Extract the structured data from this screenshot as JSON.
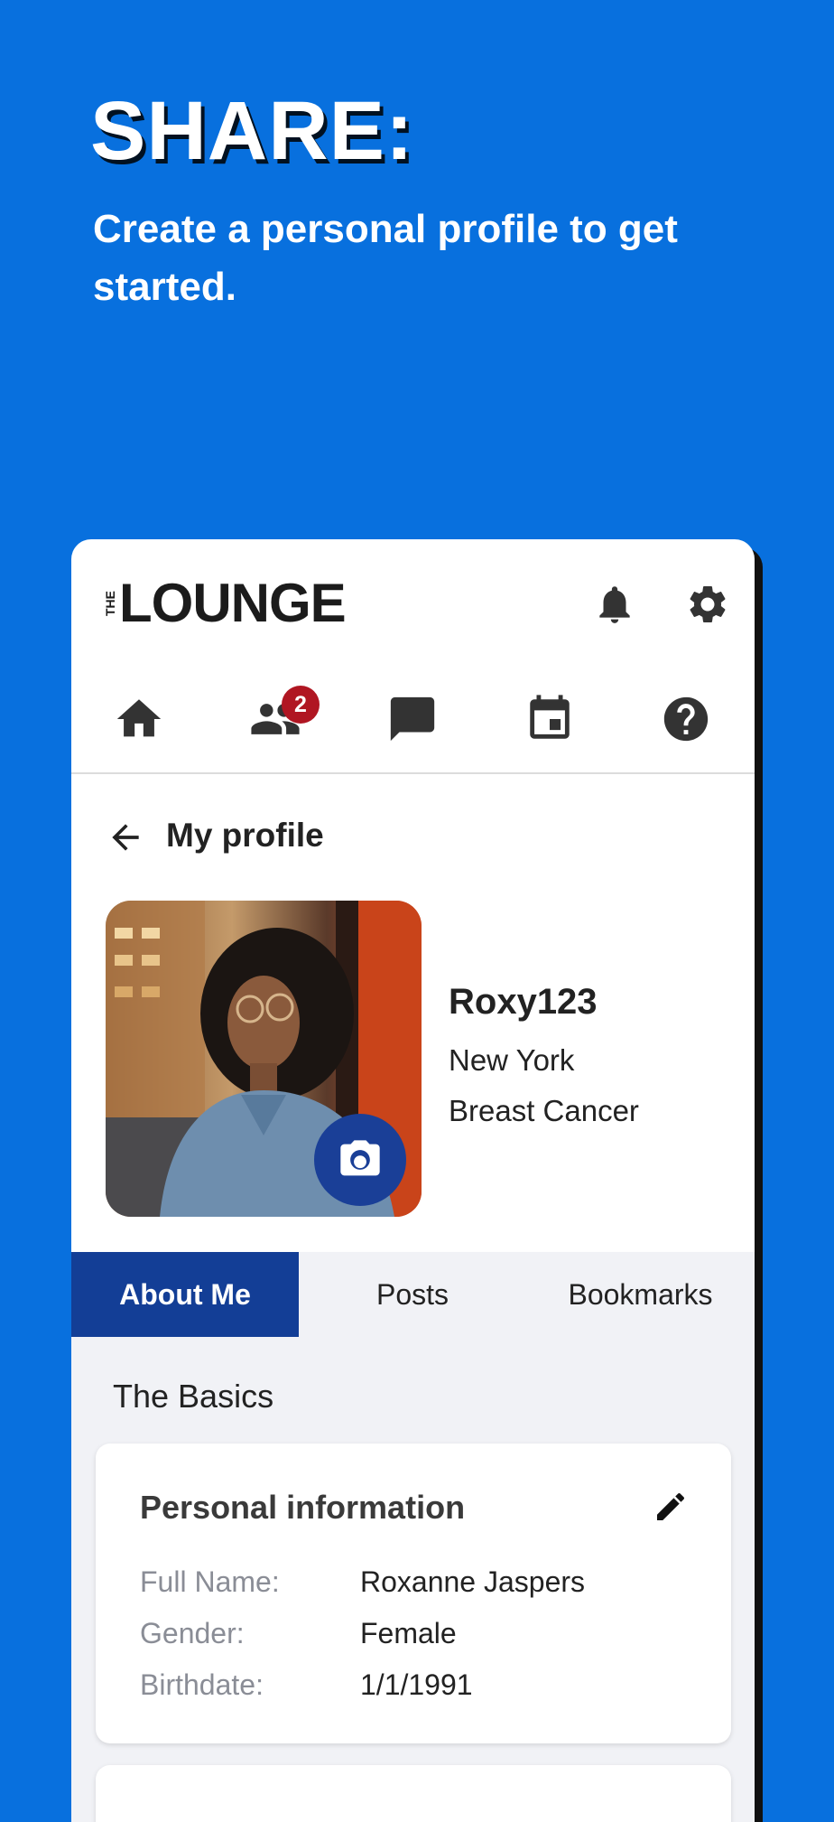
{
  "promo": {
    "heading": "SHARE:",
    "subtitle": "Create a personal profile to get started."
  },
  "app": {
    "logo_small": "THE",
    "logo_word": "LOUNGE",
    "header_icons": [
      "bell-icon",
      "gear-icon"
    ]
  },
  "nav": {
    "items": [
      "home-icon",
      "people-icon",
      "chat-icon",
      "calendar-icon",
      "help-icon"
    ],
    "people_badge": "2"
  },
  "profile": {
    "page_title": "My profile",
    "username": "Roxy123",
    "location": "New York",
    "condition": "Breast Cancer"
  },
  "tabs": {
    "items": [
      "About Me",
      "Posts",
      "Bookmarks"
    ],
    "active": "About Me"
  },
  "basics": {
    "section_title": "The Basics",
    "card_title": "Personal information",
    "fields": [
      {
        "label": "Full Name:",
        "value": "Roxanne Jaspers"
      },
      {
        "label": "Gender:",
        "value": "Female"
      },
      {
        "label": "Birthdate:",
        "value": "1/1/1991"
      }
    ]
  },
  "colors": {
    "background": "#0870DE",
    "accent": "#133E96",
    "badge": "#B01622"
  }
}
